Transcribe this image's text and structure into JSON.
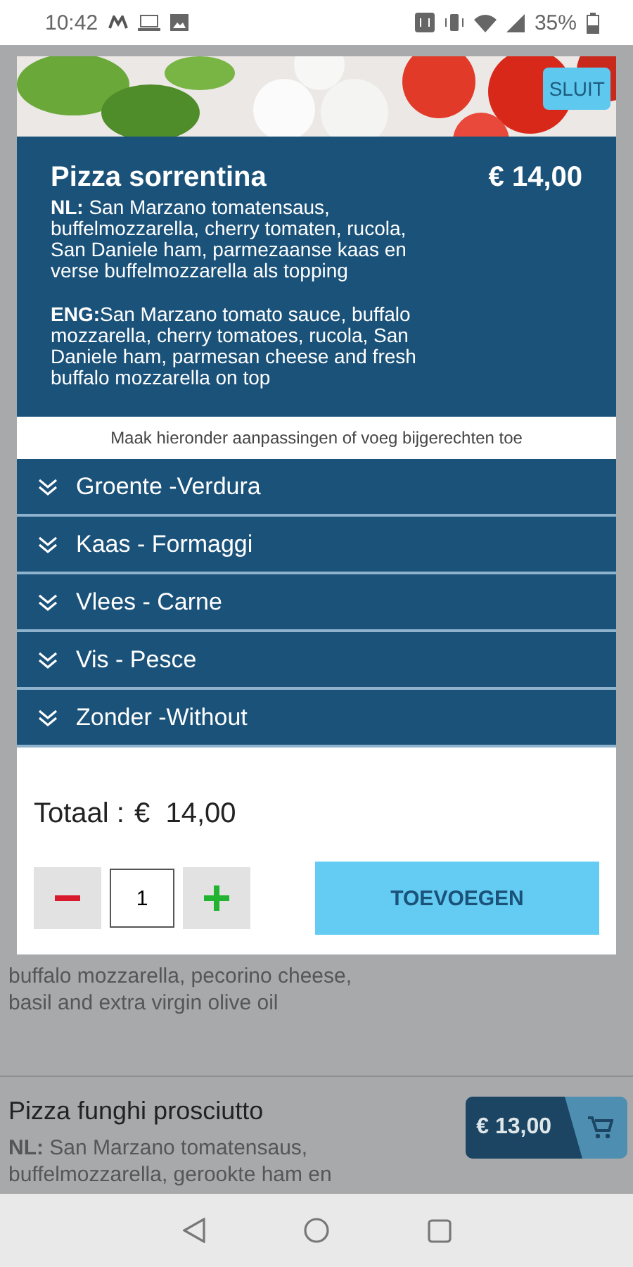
{
  "status_bar": {
    "time": "10:42",
    "battery": "35%"
  },
  "modal": {
    "close_label": "SLUIT",
    "title": "Pizza sorrentina",
    "price": "€ 14,00",
    "descriptions": [
      {
        "text": "**NL:** San Marzano tomatensaus,\nbuffelmozzarella, cherry tomaten, rucola,\nSan Daniele ham, parmezaanse kaas en\nverse buffelmozzarella als topping"
      },
      {
        "text": "**ENG:**San Marzano tomato sauce, buffalo\nmozzarella, cherry tomatoes, rucola, San\nDaniele ham, parmesan cheese and fresh\nbuffalo mozzarella on top"
      }
    ],
    "hint": "Maak hieronder aanpassingen of voeg bijgerechten toe",
    "categories": [
      {
        "label": "Groente -Verdura",
        "expanded": false
      },
      {
        "label": "Kaas - Formaggi",
        "expanded": false
      },
      {
        "label": "Vlees - Carne",
        "expanded": false
      },
      {
        "label": "Vis - Pesce",
        "expanded": false
      },
      {
        "label": "Zonder -Without",
        "expanded": false
      }
    ],
    "total_label": "Totaal :",
    "total": "€  14,00",
    "quantity": "1",
    "add_label": "TOEVOEGEN"
  },
  "background": {
    "partial_text": "buffalo mozzarella, pecorino cheese,\nbasil and extra virgin olive oil",
    "items": [
      {
        "name": "Pizza funghi prosciutto",
        "description": "**NL:** San Marzano tomatensaus,\nbuffelmozzarella, gerookte ham en",
        "price": "€ 13,00"
      }
    ]
  }
}
